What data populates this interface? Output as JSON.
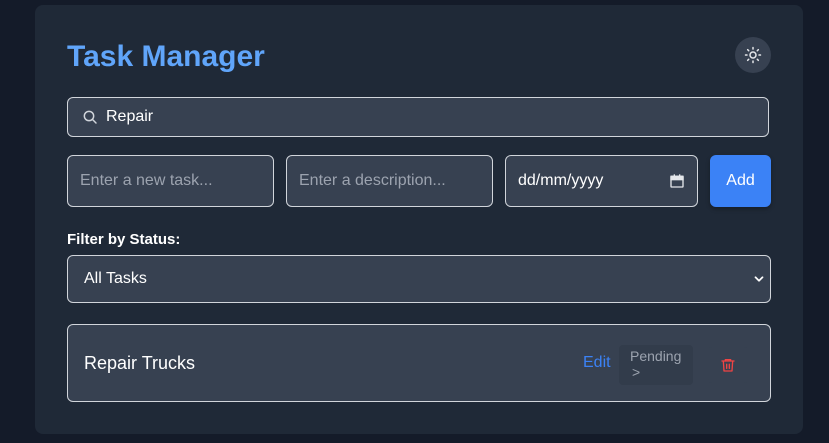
{
  "app": {
    "title": "Task Manager"
  },
  "theme_toggle": {
    "icon": "sun-icon"
  },
  "search": {
    "value": "Repair",
    "icon": "search-icon"
  },
  "new_task": {
    "title_placeholder": "Enter a new task...",
    "description_placeholder": "Enter a description...",
    "date_placeholder": "dd/mm/yyyy",
    "date_icon": "calendar-icon",
    "add_label": "Add"
  },
  "filter": {
    "label": "Filter by Status:",
    "selected": "All Tasks",
    "icon": "chevron-down-icon"
  },
  "tasks": [
    {
      "title": "Repair Trucks",
      "edit_label": "Edit",
      "status_label": "Pending",
      "status_arrow": ">",
      "delete_icon": "trash-icon"
    }
  ],
  "colors": {
    "background": "#141b29",
    "card": "#1f2937",
    "accent": "#3b82f6",
    "title": "#60a5fa",
    "delete": "#ef4444"
  }
}
